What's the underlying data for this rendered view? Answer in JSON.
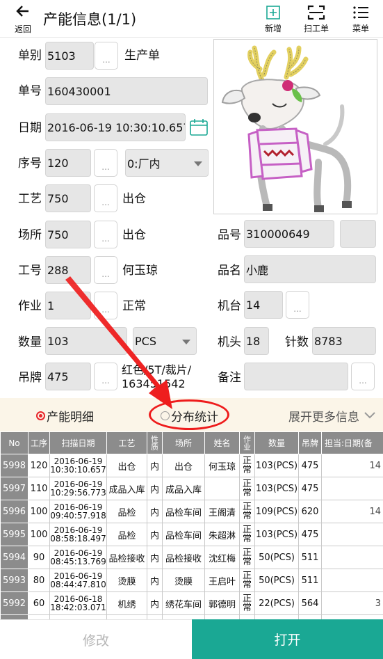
{
  "topbar": {
    "back_label": "返回",
    "title": "产能信息(1/1)",
    "add_label": "新增",
    "scan_label": "扫工单",
    "menu_label": "菜单"
  },
  "form": {
    "dan_bie": {
      "label": "单别",
      "value": "5103",
      "dots": "...",
      "name": "生产单"
    },
    "dan_hao": {
      "label": "单号",
      "value": "160430001"
    },
    "ri_qi": {
      "label": "日期",
      "value": "2016-06-19 10:30:10.657"
    },
    "xu_hao": {
      "label": "序号",
      "value": "120",
      "dots": "...",
      "select": "0:厂内"
    },
    "gong_yi": {
      "label": "工艺",
      "value": "750",
      "dots": "...",
      "name": "出仓"
    },
    "chang_suo": {
      "label": "场所",
      "value": "750",
      "dots": "...",
      "name": "出仓"
    },
    "gong_hao": {
      "label": "工号",
      "value": "288",
      "dots": "...",
      "name": "何玉琼"
    },
    "zuo_ye": {
      "label": "作业",
      "value": "1",
      "dots": "...",
      "name": "正常"
    },
    "shu_liang": {
      "label": "数量",
      "value": "103",
      "unit": "PCS"
    },
    "diao_pai": {
      "label": "吊牌",
      "value": "475",
      "dots": "...",
      "name_line1": "红色/5T/裁片/",
      "name_line2": "163451542"
    },
    "pin_hao": {
      "label": "品号",
      "value": "310000649"
    },
    "pin_ming": {
      "label": "品名",
      "value": "小鹿"
    },
    "ji_tai": {
      "label": "机台",
      "value": "14",
      "dots": "..."
    },
    "ji_tou": {
      "label": "机头",
      "value": "18"
    },
    "zhen_shu": {
      "label": "针数",
      "value": "8783"
    },
    "bei_zhu": {
      "label": "备注",
      "value": "",
      "dots": "..."
    }
  },
  "tabs": {
    "detail": "产能明细",
    "stats": "分布统计",
    "expand": "展开更多信息"
  },
  "table": {
    "headers": [
      "No",
      "工序",
      "扫描日期",
      "工艺",
      "性质",
      "场所",
      "姓名",
      "作业",
      "数量",
      "吊牌",
      "担当:日期(备"
    ],
    "rows": [
      {
        "no": "5998",
        "seq": "120",
        "date": "2016-06-19",
        "time": "10:30:10.657",
        "proc": "出仓",
        "nature": "内",
        "place": "出仓",
        "name": "何玉琼",
        "work": "正常",
        "qty": "103(PCS)",
        "tag": "475",
        "extra": "14"
      },
      {
        "no": "5997",
        "seq": "110",
        "date": "2016-06-19",
        "time": "10:29:56.773",
        "proc": "成品入库",
        "nature": "内",
        "place": "成品入库",
        "name": "",
        "work": "正常",
        "qty": "103(PCS)",
        "tag": "475",
        "extra": ""
      },
      {
        "no": "5996",
        "seq": "100",
        "date": "2016-06-19",
        "time": "09:40:57.918",
        "proc": "品检",
        "nature": "内",
        "place": "品检车间",
        "name": "王阁清",
        "work": "正常",
        "qty": "109(PCS)",
        "tag": "620",
        "extra": "14"
      },
      {
        "no": "5995",
        "seq": "100",
        "date": "2016-06-19",
        "time": "08:58:18.497",
        "proc": "品检",
        "nature": "内",
        "place": "品检车间",
        "name": "朱超淋",
        "work": "正常",
        "qty": "103(PCS)",
        "tag": "475",
        "extra": ""
      },
      {
        "no": "5994",
        "seq": "90",
        "date": "2016-06-19",
        "time": "08:45:13.769",
        "proc": "品检接收",
        "nature": "内",
        "place": "品检接收",
        "name": "沈红梅",
        "work": "正常",
        "qty": "50(PCS)",
        "tag": "511",
        "extra": ""
      },
      {
        "no": "5993",
        "seq": "80",
        "date": "2016-06-19",
        "time": "08:44:47.810",
        "proc": "烫膜",
        "nature": "内",
        "place": "烫膜",
        "name": "王启叶",
        "work": "正常",
        "qty": "50(PCS)",
        "tag": "511",
        "extra": ""
      },
      {
        "no": "5992",
        "seq": "60",
        "date": "2016-06-18",
        "time": "18:42:03.071",
        "proc": "机绣",
        "nature": "内",
        "place": "绣花车间",
        "name": "郭德明",
        "work": "正常",
        "qty": "22(PCS)",
        "tag": "564",
        "extra": "3"
      },
      {
        "no": "",
        "seq": "",
        "date": "2016-06-18",
        "time": "",
        "proc": "",
        "nature": "",
        "place": "",
        "name": "",
        "work": "正",
        "qty": "",
        "tag": "",
        "extra": ""
      }
    ]
  },
  "bottom": {
    "edit_label": "修改",
    "open_label": "打开"
  },
  "colors": {
    "accent": "#1aa894",
    "tab_bg": "#fbf5e8",
    "annotation_red": "#ee1c1c",
    "header_gray": "#8c8c8c"
  },
  "icons": {
    "back": "arrow-left-icon",
    "add": "plus-square-icon",
    "scan": "scan-frame-icon",
    "menu": "hamburger-icon",
    "calendar": "calendar-icon",
    "expand": "chevron-down-icon"
  }
}
